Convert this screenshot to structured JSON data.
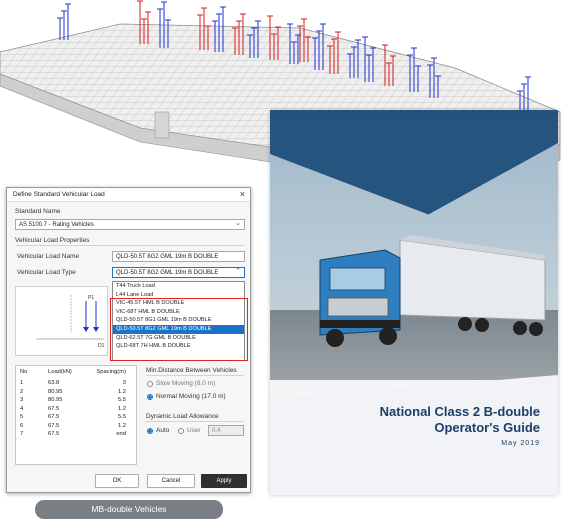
{
  "dialog": {
    "title": "Define Standard Vehicular Load",
    "close_glyph": "×",
    "standard_name_label": "Standard Name",
    "standard_name_value": "AS 5100.7 - Rating Vehicles",
    "properties_label": "Vehicular Load Properties",
    "load_name_label": "Vehicular Load Name",
    "load_name_value": "QLD-50.5T 8G2 GML 19m B DOUBLE",
    "load_type_label": "Vehicular Load Type",
    "load_type_value": "QLD-50.5T 8G2 GML 19m B DOUBLE",
    "dropdown_options": [
      "T44 Truck Load",
      "L44 Lane Load",
      "VIC-45.5T HML B DOUBLE",
      "VIC-68T HML B DOUBLE",
      "QLD-50.5T 8G1 GML 19m B DOUBLE",
      "QLD-50.5T 8G2 GML 19m B DOUBLE",
      "QLD-62.5T 7G GML B DOUBLE",
      "QLD-68T 7H HML B DOUBLE"
    ],
    "selected_option_index": 5,
    "preview_labels": {
      "p1": "P1",
      "d1": "D1"
    },
    "table": {
      "headers": [
        "No",
        "Load(kN)",
        "Spacing(m)"
      ],
      "rows": [
        [
          "1",
          "63.8",
          "3"
        ],
        [
          "2",
          "80.95",
          "1.2"
        ],
        [
          "3",
          "80.95",
          "5.5"
        ],
        [
          "4",
          "67.5",
          "1.2"
        ],
        [
          "5",
          "67.5",
          "5.5"
        ],
        [
          "6",
          "67.5",
          "1.2"
        ],
        [
          "7",
          "67.5",
          "end"
        ]
      ]
    },
    "min_distance": {
      "label": "Min.Distance Between Vehicles",
      "slow": "Slow Moving (8.0 m)",
      "normal": "Normal Moving (17.0 m)",
      "selected": "normal"
    },
    "dynamic_load": {
      "label": "Dynamic Load Allowance",
      "auto": "Auto",
      "user": "User",
      "value": "0.4",
      "selected": "auto"
    },
    "buttons": {
      "ok": "OK",
      "cancel": "Cancel",
      "apply": "Apply"
    }
  },
  "cover": {
    "title_line1": "National Class 2 B-double",
    "title_line2": "Operator's Guide",
    "date": "May 2019"
  },
  "caption": "MB-double Vehicles",
  "colors": {
    "selection": "#1a73c9",
    "highlight_border": "#e02323",
    "load_blue": "#1f2fd0",
    "load_red": "#d81a1a",
    "cover_navy": "#1d3f66"
  }
}
